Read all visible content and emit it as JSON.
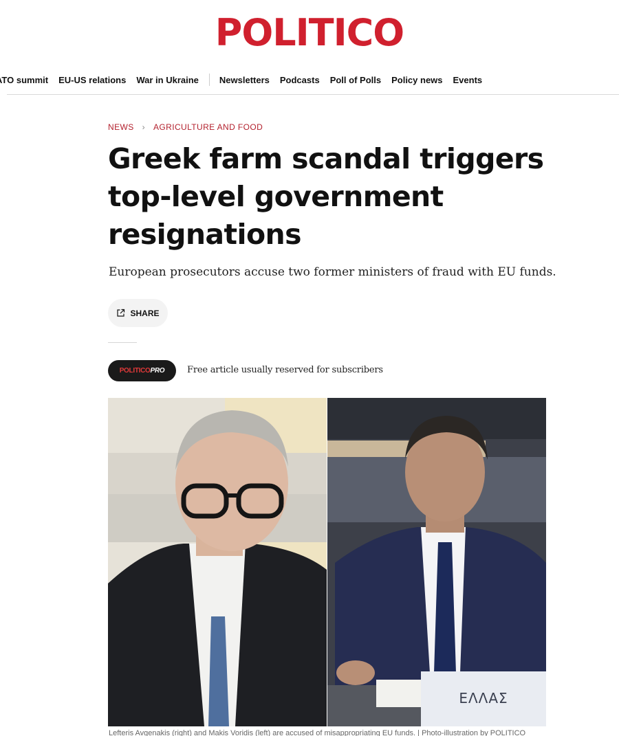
{
  "brand": {
    "logo_text": "POLITICO",
    "accent_color": "#d0202e"
  },
  "nav": {
    "items": [
      "ATO summit",
      "EU-US relations",
      "War in Ukraine"
    ],
    "items_right": [
      "Newsletters",
      "Podcasts",
      "Poll of Polls",
      "Policy news",
      "Events"
    ]
  },
  "breadcrumb": {
    "section": "NEWS",
    "subsection": "AGRICULTURE AND FOOD"
  },
  "article": {
    "headline": "Greek farm scandal triggers top-level government resignations",
    "dek": "European prosecutors accuse two former ministers of fraud with EU funds.",
    "share_label": "SHARE",
    "pro_badge": {
      "part1": "POLITICO",
      "part2": "PRO"
    },
    "pro_note": "Free article usually reserved for subscribers",
    "photo": {
      "nameplate": "ΕΛΛΑΣ",
      "caption": "Lefteris Avgenakis (right) and Makis Voridis (left) are accused of misappropriating EU funds. | Photo-illustration by POLITICO"
    }
  }
}
